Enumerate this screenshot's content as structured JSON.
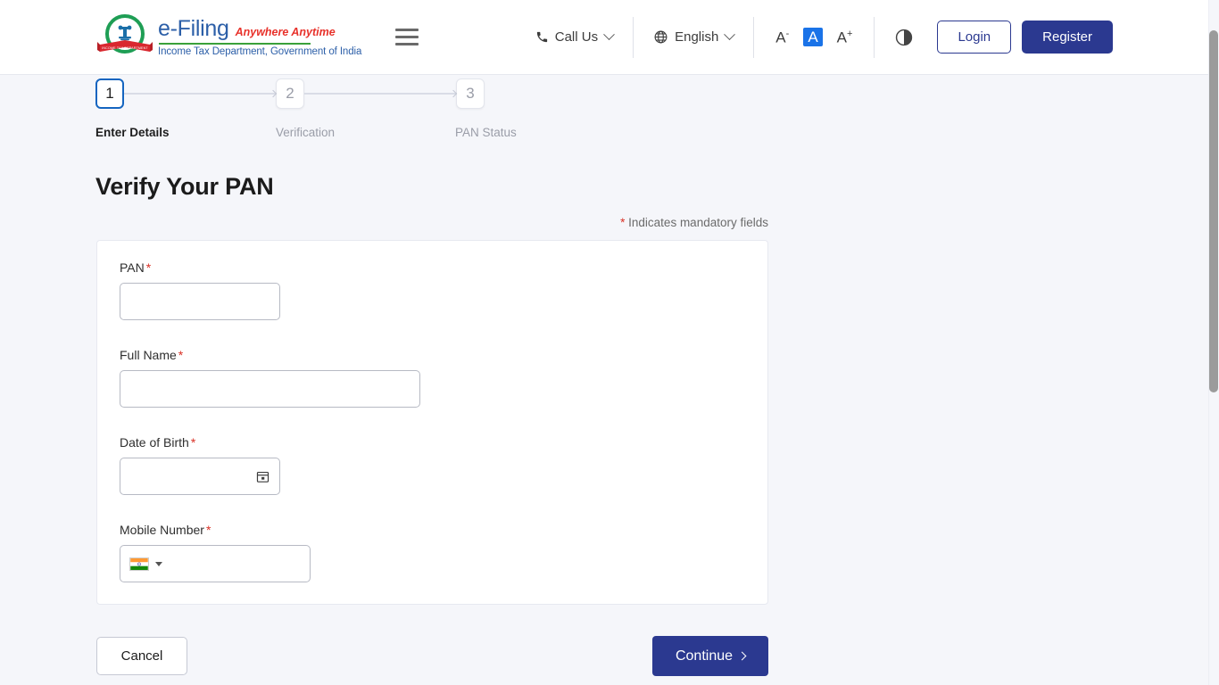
{
  "header": {
    "logo": {
      "emblem_alt": "income-tax-department-emblem",
      "brand": "e-Filing",
      "tagline": "Anywhere Anytime",
      "department": "Income Tax Department, Government of India"
    },
    "menu_icon": "hamburger-menu-icon",
    "call_us": {
      "label": "Call Us",
      "icon": "phone-icon",
      "caret": "chevron-down-icon"
    },
    "language": {
      "label": "English",
      "icon": "globe-icon",
      "caret": "chevron-down-icon"
    },
    "font_size": {
      "decrease": "A",
      "decrease_sup": "-",
      "normal": "A",
      "increase": "A",
      "increase_sup": "+",
      "active": "normal",
      "active_color": "#1a73e8"
    },
    "contrast_icon": "contrast-half-circle-icon",
    "login_label": "Login",
    "register_label": "Register"
  },
  "stepper": {
    "steps": [
      {
        "number": "1",
        "label": "Enter Details",
        "state": "active"
      },
      {
        "number": "2",
        "label": "Verification",
        "state": "inactive"
      },
      {
        "number": "3",
        "label": "PAN Status",
        "state": "inactive"
      }
    ],
    "active_color": "#1565c0"
  },
  "main": {
    "title": "Verify Your PAN",
    "mandatory_star": "*",
    "mandatory_note": "Indicates mandatory fields",
    "fields": [
      {
        "label": "PAN",
        "required": "*",
        "value": "",
        "placeholder": ""
      },
      {
        "label": "Full Name",
        "required": "*",
        "value": "",
        "placeholder": ""
      },
      {
        "label": "Date of Birth",
        "required": "*",
        "value": "",
        "placeholder": "",
        "icon": "calendar-icon"
      },
      {
        "label": "Mobile Number",
        "required": "*",
        "value": "",
        "placeholder": "",
        "icon": "india-flag-icon"
      }
    ]
  },
  "actions": {
    "cancel_label": "Cancel",
    "continue_label": "Continue",
    "continue_icon": "chevron-right-icon",
    "primary_color": "#2b3990"
  }
}
